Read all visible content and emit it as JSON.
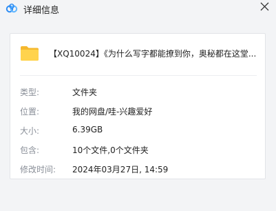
{
  "window": {
    "title": "详细信息",
    "close_glyph": "✕",
    "logo_icon": "baidu-netdisk-cloud-icon"
  },
  "file": {
    "icon": "folder-icon",
    "name": "【XQ10024】《为什么写字都能撩到你，奥秘都在这堂..."
  },
  "details": [
    {
      "label": "类型:",
      "value": "文件夹"
    },
    {
      "label": "位置:",
      "value": "我的网盘/哇-兴趣爱好"
    },
    {
      "label": "大小:",
      "value": "6.39GB"
    },
    {
      "label": "包含:",
      "value": "10个文件,0个文件夹"
    },
    {
      "label": "修改时间:",
      "value": "2024年03月27日, 14:59"
    }
  ],
  "colors": {
    "accent": "#2c8cf4",
    "folder": "#f7c948",
    "label": "#8a8f98"
  }
}
